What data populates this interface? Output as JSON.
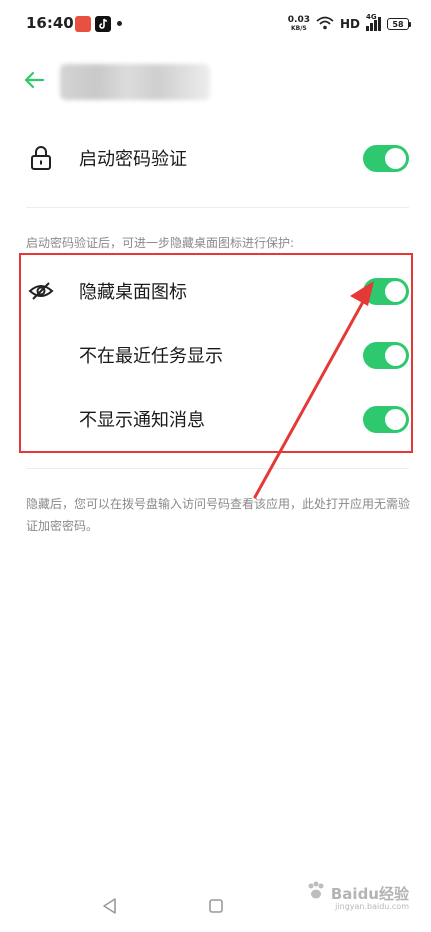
{
  "status_bar": {
    "time": "16:40",
    "net_speed_value": "0.03",
    "net_speed_unit": "KB/S",
    "hd_label": "HD",
    "signal_label": "4G",
    "battery": "58",
    "icons": [
      "weibo-app-icon",
      "tiktok-app-icon",
      "wifi-icon",
      "signal-icon",
      "battery-icon"
    ]
  },
  "header": {
    "back_icon": "arrow-left-icon"
  },
  "settings": {
    "password_row": {
      "label": "启动密码验证",
      "icon": "lock-icon",
      "enabled": true
    },
    "section_hint": "启动密码验证后，可进一步隐藏桌面图标进行保护:",
    "hide_icon_row": {
      "label": "隐藏桌面图标",
      "icon": "eye-off-icon",
      "enabled": true
    },
    "recent_tasks_row": {
      "label": "不在最近任务显示",
      "enabled": true
    },
    "notification_row": {
      "label": "不显示通知消息",
      "enabled": true
    },
    "footer_hint": "隐藏后，您可以在拨号盘输入访问号码查看该应用，此处打开应用无需验证加密密码。"
  },
  "colors": {
    "accent": "#2ec86f",
    "annotation": "#e53935"
  },
  "nav": {
    "icons": [
      "back-triangle-icon",
      "home-square-icon"
    ]
  },
  "watermark": {
    "text": "Baidu经验",
    "sub": "jingyan.baidu.com"
  }
}
